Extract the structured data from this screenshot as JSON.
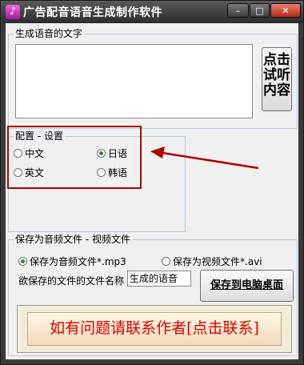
{
  "window": {
    "title": "广告配音语音生成制作软件",
    "icon": "music-note-icon",
    "min_label": "–",
    "max_label": "□",
    "close_label": "✕"
  },
  "text_group": {
    "legend": "生成语音的文字",
    "content": "",
    "listen_button": "点击试听内容"
  },
  "config_group": {
    "legend": "配置 - 设置",
    "options": [
      {
        "label": "中文",
        "selected": false
      },
      {
        "label": "日语",
        "selected": true
      },
      {
        "label": "英文",
        "selected": false
      },
      {
        "label": "韩语",
        "selected": false
      }
    ]
  },
  "save_group": {
    "legend": "保存为音频文件 - 视频文件",
    "audio_option": "保存为音频文件*.mp3",
    "video_option": "保存为视频文件*.avi",
    "audio_selected": true,
    "filename_label": "欲保存的文件的文件名称",
    "filename_value": "生成的语音",
    "save_button": "保存到电脑桌面"
  },
  "contact_button": "如有问题请联系作者[点击联系]",
  "colors": {
    "annotation_red": "#b00000",
    "contact_text": "#e00000",
    "radio_selected": "#2e8b2e"
  }
}
